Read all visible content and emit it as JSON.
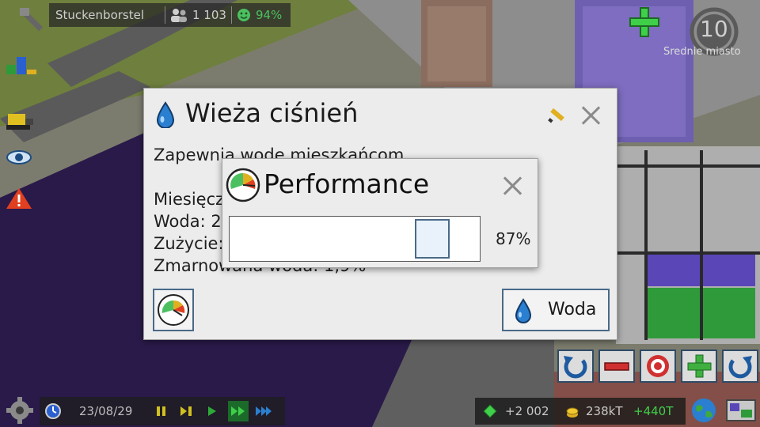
{
  "topbar": {
    "city_name": "Stuckenborstel",
    "population": "1 103",
    "happiness": "94%"
  },
  "right_hud": {
    "level": "10",
    "level_caption": "Średnie miasto"
  },
  "building_dialog": {
    "title": "Wieża ciśnień",
    "description": "Zapewnia wodę mieszkańcom",
    "line_monthly": "Miesięcz",
    "line_water": "Woda: 2",
    "line_usage": "Zużycie:",
    "line_wasted": "Zmarnowana woda: 1,9%",
    "water_button_label": "Woda"
  },
  "performance_dialog": {
    "title": "Performance",
    "value_label": "87%",
    "value": 0.87
  },
  "bottombar": {
    "date": "23/08/29"
  },
  "money": {
    "balance": "+2 002",
    "income": "238kT",
    "income_change": "+440T"
  },
  "colors": {
    "dialog_bg": "#ececec",
    "button_border": "#4a6a88",
    "water_drop": "#2a7fd0",
    "happy_green": "#4cc060",
    "zone_purple": "#5b46b8",
    "zone_green": "#2f9a3a"
  },
  "icons": [
    "hammer-icon",
    "people-icon",
    "smiley-icon",
    "plus-icon",
    "gear-icon",
    "eye-icon",
    "warning-icon",
    "bulldozer-icon",
    "water-drop-icon",
    "pencil-icon",
    "close-icon",
    "gauge-icon",
    "clock-icon",
    "pause-icon",
    "play-icon",
    "fast-forward-icon",
    "rotate-left-icon",
    "minus-icon",
    "target-icon",
    "rotate-right-icon",
    "diamond-icon",
    "coins-icon",
    "globe-icon",
    "map-icon"
  ]
}
